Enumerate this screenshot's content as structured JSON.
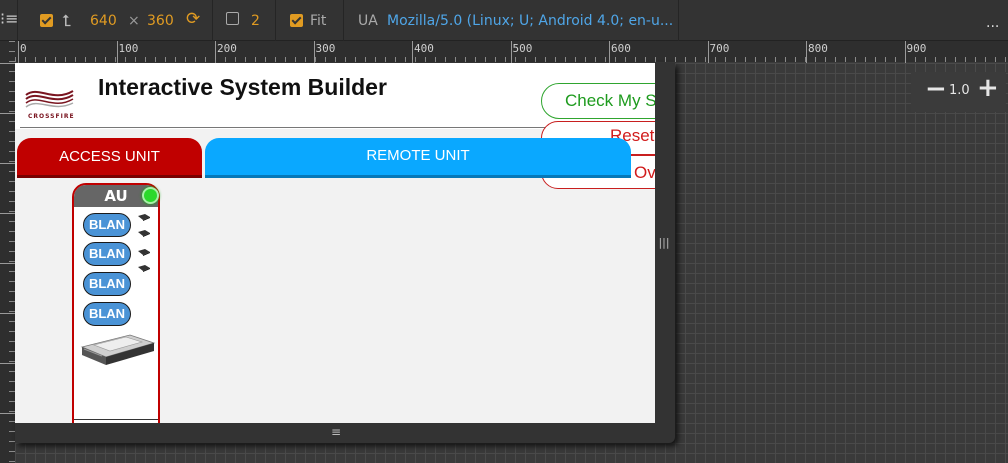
{
  "toolbar": {
    "width": "640",
    "times": "×",
    "height": "360",
    "dpr": "2",
    "fit_label": "Fit",
    "ua_label": "UA",
    "ua_value": "Mozilla/5.0 (Linux; U; Android 4.0; en-u...",
    "more": "..."
  },
  "ruler": {
    "labels": [
      "0",
      "100",
      "200",
      "300",
      "400",
      "500",
      "600",
      "700",
      "800",
      "900"
    ]
  },
  "zoom": {
    "minus": "−",
    "value": "1.0",
    "plus": "+"
  },
  "app": {
    "logo_text": "CROSSFIRE",
    "title": "Interactive System Builder",
    "check_label": "Check My S",
    "reset_label": "Reset",
    "over_label": "Ov",
    "tab_access": "ACCESS UNIT",
    "tab_remote": "REMOTE UNIT",
    "au_title": "AU",
    "blan_labels": [
      "BLAN",
      "BLAN",
      "BLAN",
      "BLAN"
    ]
  },
  "colors": {
    "access_tab": "#c00000",
    "remote_tab": "#0aa8ff",
    "check_green": "#1e9b1e",
    "reset_red": "#d11b1b",
    "status_green": "#2bd92b",
    "toolbar_accent": "#e09b22"
  },
  "handles": {
    "side": "|||",
    "bottom": "≡"
  }
}
